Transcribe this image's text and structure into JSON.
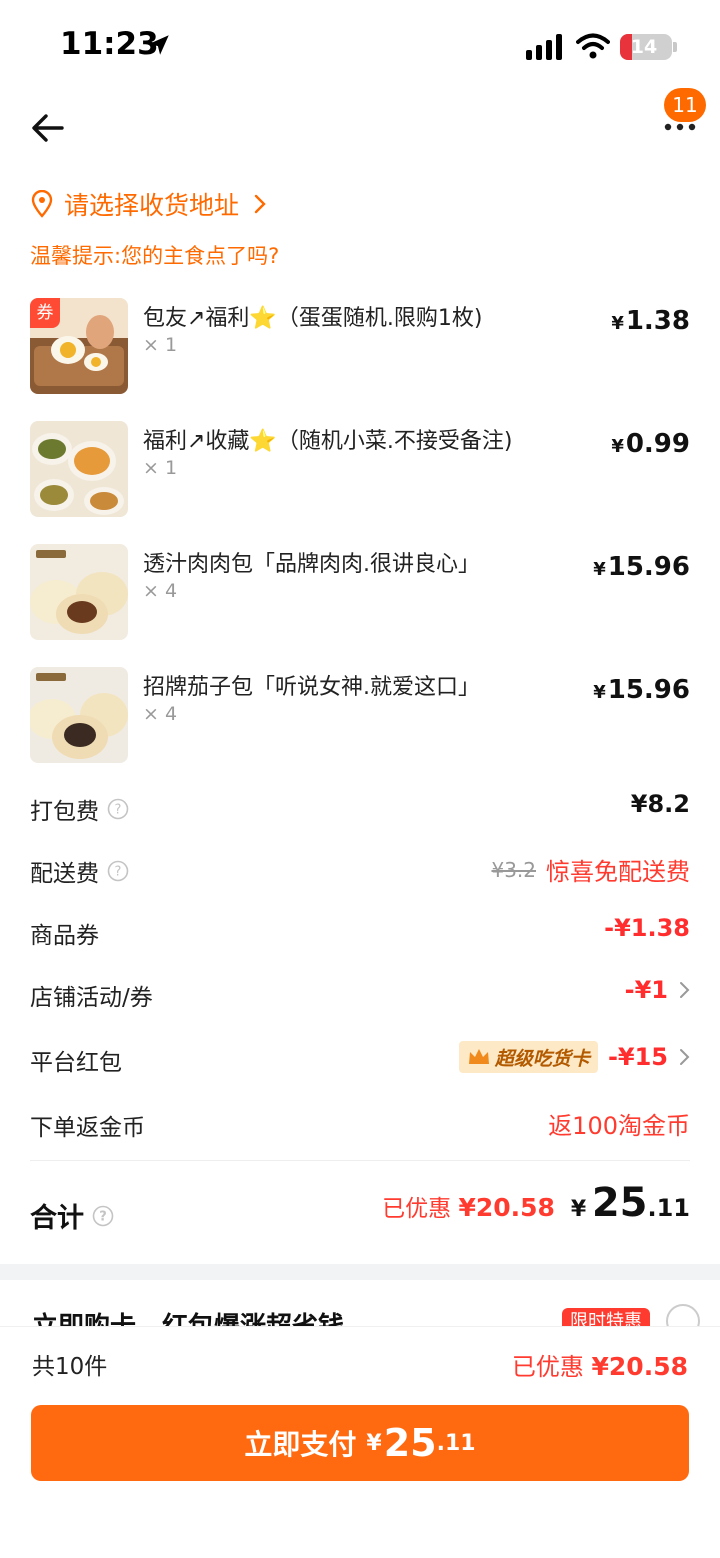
{
  "status_bar": {
    "time": "11:23",
    "battery": "14"
  },
  "nav": {
    "badge_count": "11"
  },
  "address": {
    "label": "请选择收货地址"
  },
  "tip": "温馨提示:您的主食点了吗?",
  "items": [
    {
      "name": "包友↗福利⭐️（蛋蛋随机.限购1枚)",
      "qty": "× 1",
      "yen": "¥",
      "price": "1.38",
      "coupon_tag": "券"
    },
    {
      "name": "福利↗收藏⭐️（随机小菜.不接受备注)",
      "qty": "× 1",
      "yen": "¥",
      "price": "0.99"
    },
    {
      "name": "透汁肉肉包「品牌肉肉.很讲良心」",
      "qty": "× 4",
      "yen": "¥",
      "price": "15.96"
    },
    {
      "name": "招牌茄子包「听说女神.就爱这口」",
      "qty": "× 4",
      "yen": "¥",
      "price": "15.96"
    }
  ],
  "fees": {
    "packing": {
      "label": "打包费",
      "value": "¥8.2"
    },
    "delivery": {
      "label": "配送费",
      "original": "¥3.2",
      "value": "惊喜免配送费"
    },
    "product_coupon": {
      "label": "商品券",
      "value": "-¥1.38"
    },
    "store_activity": {
      "label": "店铺活动/券",
      "value": "-¥1"
    },
    "platform_redpacket": {
      "label": "平台红包",
      "badge": "超级吃货卡",
      "value": "-¥15"
    },
    "coins": {
      "label": "下单返金币",
      "value": "返100淘金币"
    }
  },
  "total": {
    "label": "合计",
    "saved_label": "已优惠",
    "saved_value": "¥20.58",
    "yen": "¥",
    "int": "25",
    "dec": ".11"
  },
  "peek": {
    "text": "立即购卡，红包爆涨超省钱",
    "tag": "限时特惠"
  },
  "bottom": {
    "count": "共10件",
    "saved_label": "已优惠",
    "saved_value": "¥20.58",
    "pay_label": "立即支付",
    "pay_yen": "¥",
    "pay_int": "25",
    "pay_dec": ".11"
  },
  "colors": {
    "accent": "#ff6a10",
    "discount_red": "#ff3b30",
    "badge": "#ff6a00"
  }
}
